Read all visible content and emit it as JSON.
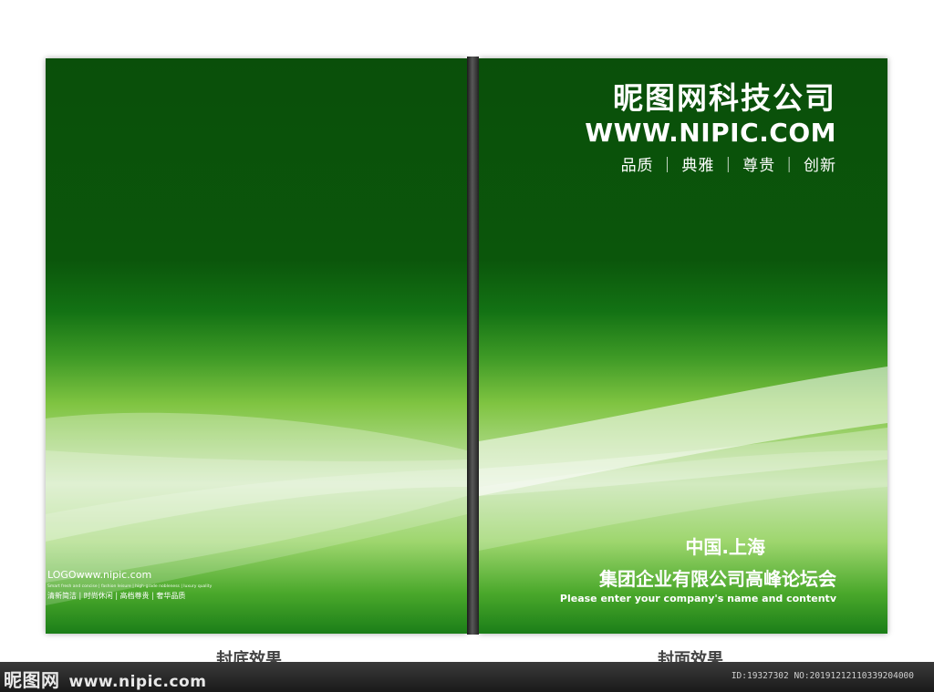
{
  "front_cover": {
    "company": "昵图网科技公司",
    "url": "WWW.NIPIC.COM",
    "tagline": "品质 ｜ 典雅 ｜ 尊贵 ｜ 创新",
    "city": "中国.上海",
    "forum": "集团企业有限公司高峰论坛会",
    "enter_text": "Please enter your company's name and contentv"
  },
  "back_cover": {
    "logo": "LOGOwww.nipic.com",
    "slogan_en": "Smart fresh and concise | fashion leisure | high-grade nobleness | luxury quality",
    "slogan_cn": "清新简洁 | 时尚休闲 | 高档尊贵 | 奢华品质"
  },
  "captions": {
    "back": "封底效果",
    "front": "封面效果"
  },
  "footer": {
    "watermark": "昵图网",
    "site": "www.nipic.com",
    "id_text": "ID:19327302 NO:20191212110339204000"
  },
  "colors": {
    "dark_green": "#0a4f0a",
    "light_green": "#a9d780",
    "spine": "#2a2a2a"
  }
}
